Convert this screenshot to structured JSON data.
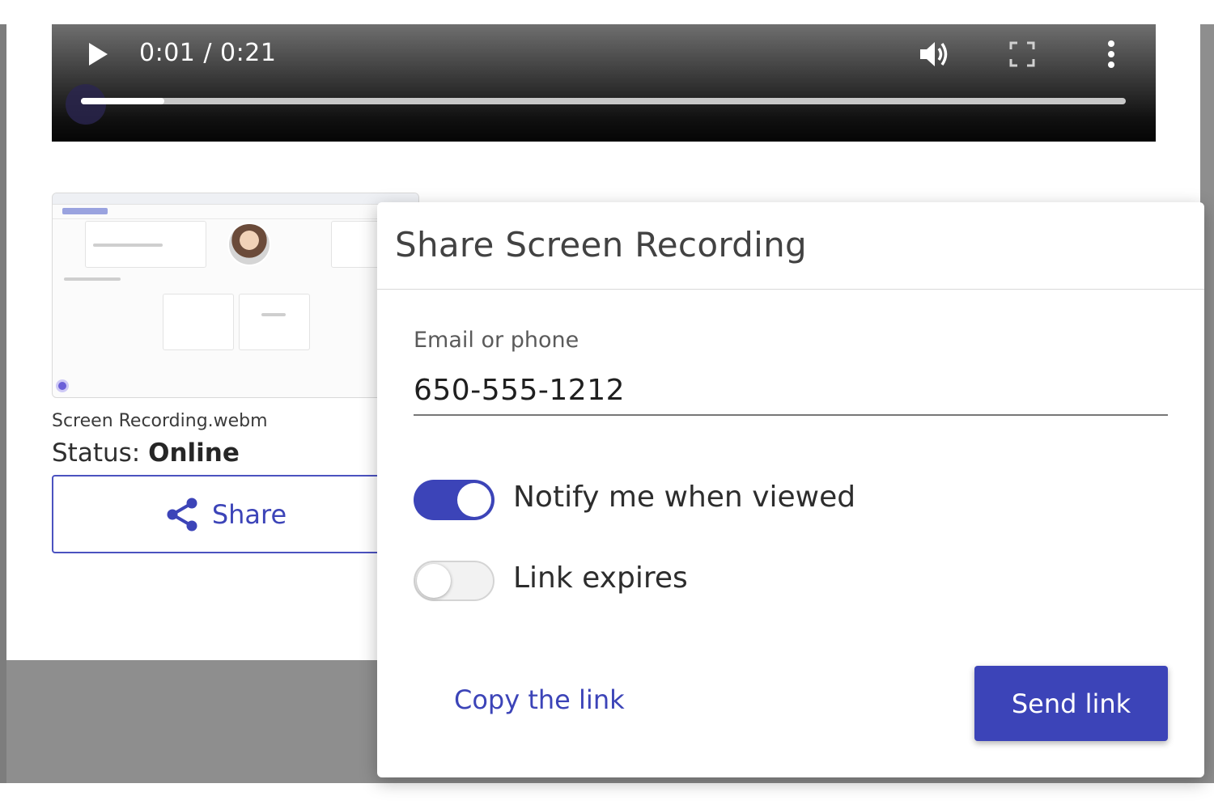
{
  "player": {
    "time": "0:01 / 0:21",
    "progress_fraction": 0.08,
    "icons": [
      "play-icon",
      "volume-icon",
      "fullscreen-icon",
      "more-vert-icon"
    ]
  },
  "recording": {
    "file_name": "Screen Recording.webm",
    "status_label": "Status: ",
    "status_value": "Online",
    "share_label": "Share"
  },
  "dialog": {
    "title": "Share Screen Recording",
    "field_label": "Email or phone",
    "field_value": "650-555-1212",
    "notify_label": "Notify me when viewed",
    "notify_on": true,
    "expires_label": "Link expires",
    "expires_on": false,
    "copy_link_label": "Copy the link",
    "send_label": "Send link"
  },
  "colors": {
    "accent": "#3c44b8",
    "backdrop": "#8e8e8e"
  }
}
